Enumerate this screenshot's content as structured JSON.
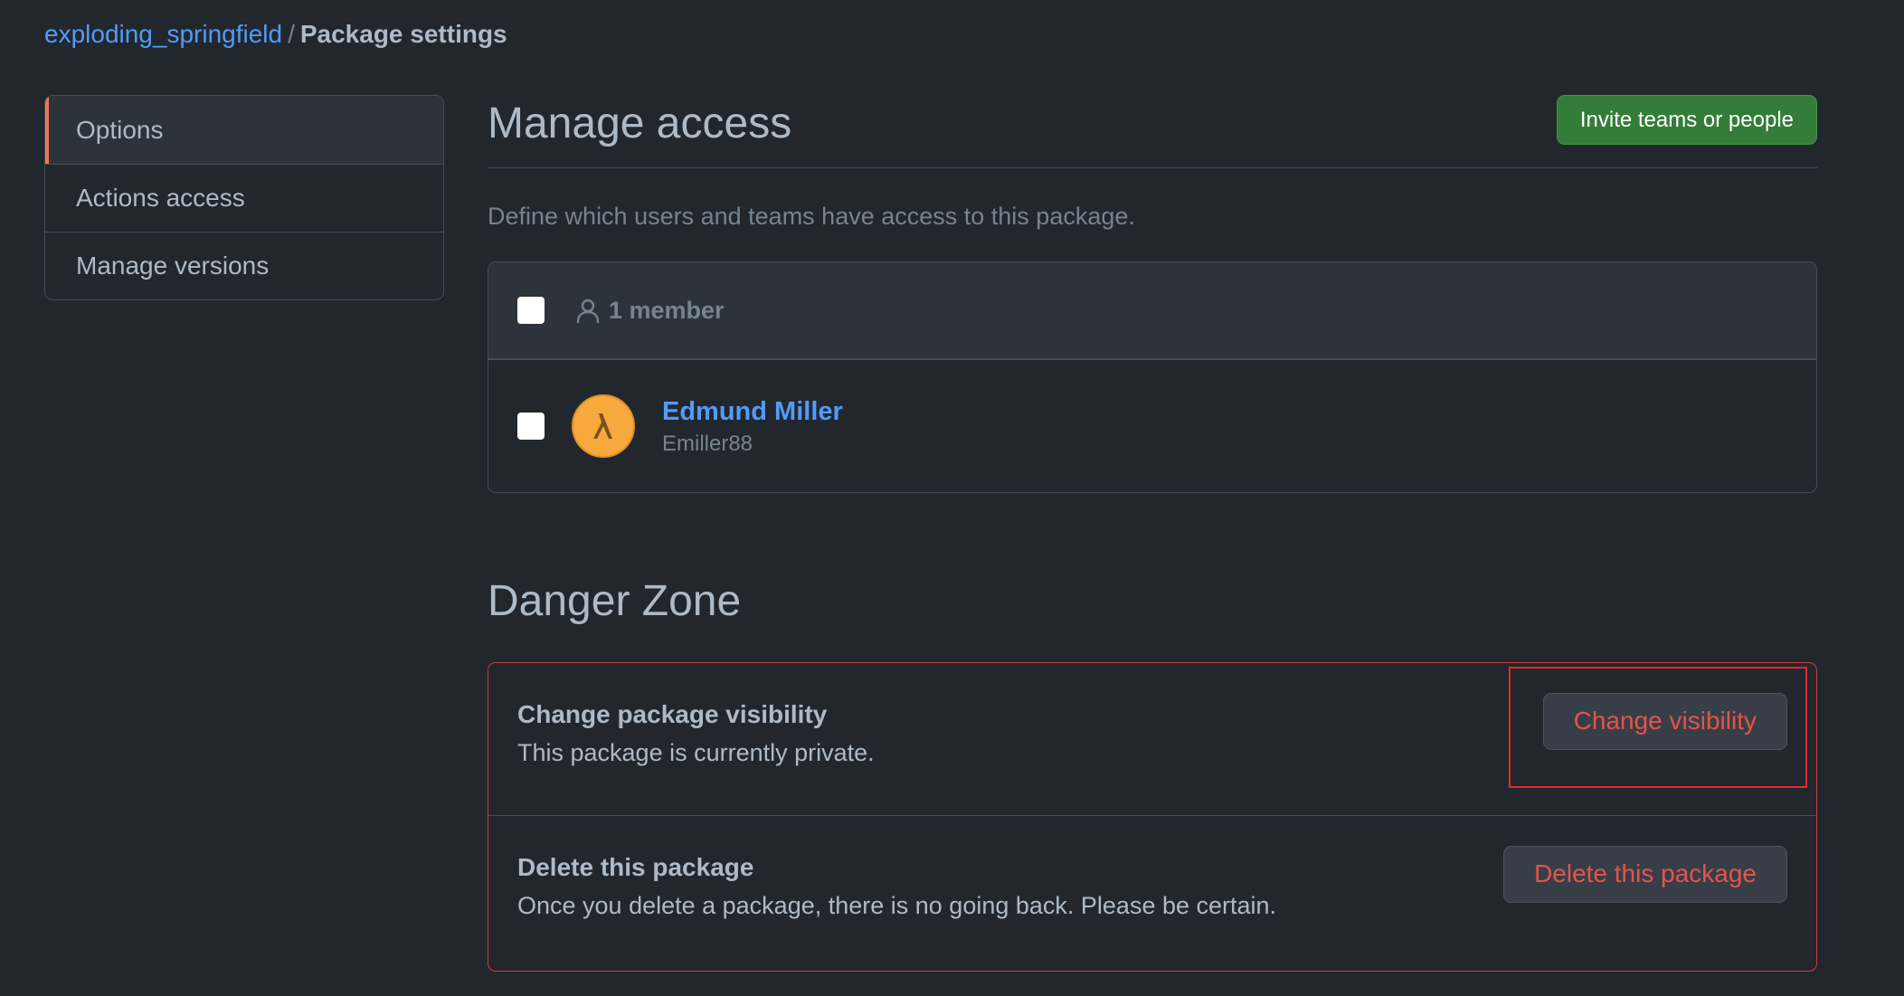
{
  "breadcrumb": {
    "owner": "exploding_springfield",
    "separator": "/",
    "current": "Package settings"
  },
  "sidebar": {
    "items": [
      {
        "label": "Options",
        "selected": true
      },
      {
        "label": "Actions access",
        "selected": false
      },
      {
        "label": "Manage versions",
        "selected": false
      }
    ]
  },
  "manage_access": {
    "title": "Manage access",
    "invite_label": "Invite teams or people",
    "description": "Define which users and teams have access to this package.",
    "member_count": "1 member",
    "members": [
      {
        "name": "Edmund Miller",
        "login": "Emiller88"
      }
    ]
  },
  "danger_zone": {
    "title": "Danger Zone",
    "visibility": {
      "heading": "Change package visibility",
      "text": "This package is currently private.",
      "button": "Change visibility"
    },
    "delete": {
      "heading": "Delete this package",
      "text": "Once you delete a package, there is no going back. Please be certain.",
      "button": "Delete this package"
    }
  },
  "colors": {
    "background": "#22272e",
    "link": "#539bf5",
    "primary_button": "#347d39",
    "danger": "#e5534b",
    "selected_indicator": "#ec775c",
    "highlight": "#e5282b"
  },
  "icons": {
    "member_count": "person-icon",
    "avatar": "identicon-avatar"
  }
}
